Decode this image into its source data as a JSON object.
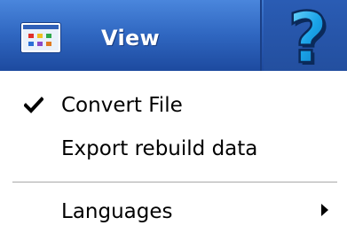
{
  "menubar": {
    "view_label": "View",
    "view_icon": "window-grid-icon",
    "help_icon": "help-question-icon"
  },
  "menu": {
    "items": [
      {
        "label": "Convert File",
        "checked": true
      },
      {
        "label": "Export rebuild data",
        "checked": false
      },
      {
        "label": "Languages",
        "has_submenu": true
      }
    ]
  },
  "colors": {
    "titlebar": "#2c5fb8",
    "help_glyph": "#1aa3e8",
    "menu_background": "#ffffff",
    "separator": "#a9a9a9"
  }
}
